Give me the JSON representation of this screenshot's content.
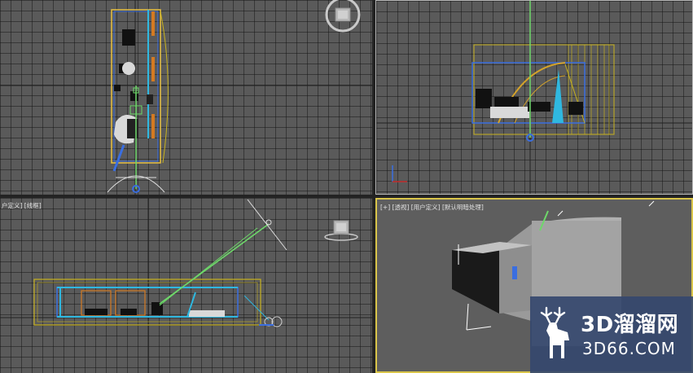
{
  "viewports": {
    "top": {
      "label": ""
    },
    "front": {
      "label": ""
    },
    "left": {
      "label": "[+] [左] [用户定义] [线框]",
      "label_visible": "户定义] [线框]"
    },
    "perspective": {
      "label": "[+] [透视] [用户定义] [默认明暗处理]"
    }
  },
  "icons": {
    "viewcube": "viewcube-icon",
    "axis_tripod": "axis-tripod-icon",
    "light": "omni-light-icon",
    "camera": "camera-icon",
    "deer_logo": "deer-logo-icon"
  },
  "colors": {
    "viewport_bg": "#5a5a5a",
    "grid": "#3a3a3a",
    "active_border": "#d9c54a",
    "selection_yellow": "#c8b21e",
    "cyan": "#2fb8e0",
    "orange": "#d47a22",
    "green": "#6ed86a",
    "watermark_bg": "#35486e"
  },
  "watermark": {
    "brand": "3D溜溜网",
    "url": "3D66.COM"
  }
}
